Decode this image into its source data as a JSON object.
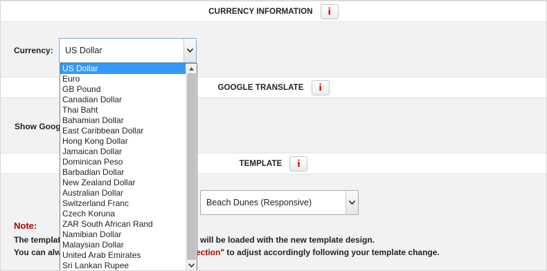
{
  "currency_section": {
    "title": "CURRENCY INFORMATION",
    "info_label": "i"
  },
  "currency_field": {
    "label": "Currency:",
    "value": "US Dollar"
  },
  "currency_options": [
    "US Dollar",
    "Euro",
    "GB Pound",
    "Canadian Dollar",
    "Thai Baht",
    "Bahamian Dollar",
    "East Caribbean Dollar",
    "Hong Kong Dollar",
    "Jamaican Dollar",
    "Dominican Peso",
    "Barbadian Dollar",
    "New Zealand Dollar",
    "Australian Dollar",
    "Switzerland Franc",
    "Czech Koruna",
    "ZAR South African Rand",
    "Namibian Dollar",
    "Malaysian Dollar",
    "United Arab Emirates",
    "Sri Lankan Rupee"
  ],
  "selected_option_index": 0,
  "google_section": {
    "title": "GOOGLE TRANSLATE",
    "info_label": "i",
    "field_label_visible": "Show Goog"
  },
  "template_section": {
    "title": "TEMPLATE",
    "info_label": "i"
  },
  "template_field": {
    "value": "Beach Dunes (Responsive)"
  },
  "note": {
    "title": "Note:",
    "line1_start": "The templat",
    "line1_end": "will be loaded with the new template design.",
    "line2_start": "You can alw",
    "line2_red": "ection",
    "line2_end": "\" to adjust accordingly following your template change."
  },
  "colors": {
    "accent_red": "#b00000",
    "highlight": "#3399ff",
    "band_bg": "#f2f2f2"
  },
  "icons": {
    "dropdown": "chevron-down-icon",
    "info": "info-icon"
  }
}
